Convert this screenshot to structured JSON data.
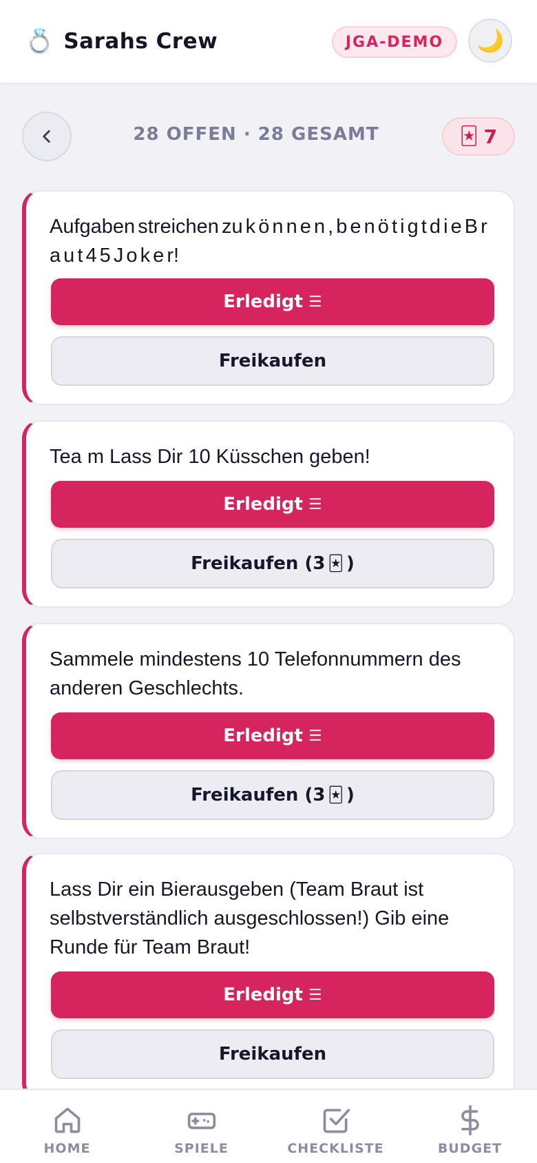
{
  "header": {
    "ring_icon": "💍",
    "title": "Sarahs Crew",
    "badge": "JGA-DEMO",
    "theme_icon": "🌙"
  },
  "subbar": {
    "status": "28 OFFEN · 28 GESAMT",
    "joker_icon": "🃏",
    "joker_count": "7"
  },
  "cards": [
    {
      "text": "Aufgaben streichen zu k ö n n e n , b e n ö t i g t d i e B r a u t 4 5 J o k e r!",
      "done_label": "Erledigt",
      "buyout_label": "Freikaufen",
      "buyout_cost": ""
    },
    {
      "text": "Tea m Lass Dir 10 Küsschen geben!",
      "done_label": "Erledigt",
      "buyout_label": "Freikaufen (3",
      "buyout_cost": ")"
    },
    {
      "text": "Sammele mindestens 10 Telefonnummern des anderen Geschlechts.",
      "done_label": "Erledigt",
      "buyout_label": "Freikaufen (3",
      "buyout_cost": ")"
    },
    {
      "text": "Lass Dir ein Bierausgeben (Team Braut ist selbstverständlich ausgeschlossen!) Gib eine Runde für Team Braut!",
      "done_label": "Erledigt",
      "buyout_label": "Freikaufen",
      "buyout_cost": ""
    }
  ],
  "nav": {
    "home": "HOME",
    "games": "SPIELE",
    "checklist": "CHECKLISTE",
    "budget": "BUDGET"
  },
  "colors": {
    "accent": "#d6245f",
    "background": "#f2f2f6",
    "muted": "#8c8ca3"
  }
}
